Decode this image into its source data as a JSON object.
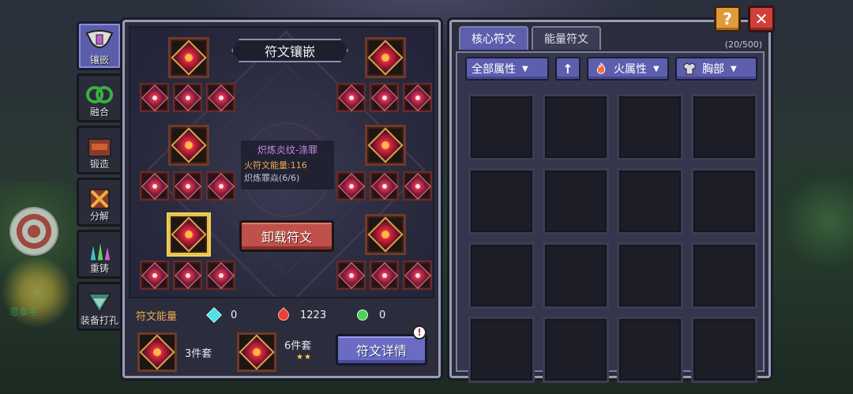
{
  "background": {
    "character_name": "恩泰手"
  },
  "tabs": [
    {
      "label": "镶嵌",
      "icon": "socket-icon",
      "active": true
    },
    {
      "label": "融合",
      "icon": "fusion-icon",
      "active": false
    },
    {
      "label": "锻造",
      "icon": "forge-icon",
      "active": false
    },
    {
      "label": "分解",
      "icon": "dismantle-icon",
      "active": false
    },
    {
      "label": "重铸",
      "icon": "recast-icon",
      "active": false
    },
    {
      "label": "装备打孔",
      "icon": "drill-icon",
      "active": false
    }
  ],
  "left_panel": {
    "title": "符文镶嵌",
    "tooltip": {
      "name": "炽炼炎纹-涤罪",
      "power": "火符文能量:116",
      "set": "炽炼罪焱(6/6)"
    },
    "unequip_label": "卸载符文",
    "energy": {
      "label": "符文能量",
      "cyan": "0",
      "red": "1223",
      "green": "0"
    },
    "sets": [
      {
        "label": "3件套",
        "stars": ""
      },
      {
        "label": "6件套",
        "stars": "★★"
      }
    ],
    "details_label": "符文详情",
    "alert": "!"
  },
  "right_panel": {
    "tabs": [
      {
        "label": "核心符文",
        "active": true
      },
      {
        "label": "能量符文",
        "active": false
      }
    ],
    "capacity": "(20/500)",
    "filters": {
      "attribute": "全部属性",
      "sort_icon": "up-arrow-icon",
      "element": "火属性",
      "slot": "胸部"
    },
    "grid_cells": 16
  },
  "colors": {
    "panel_border": "#9b9db7",
    "accent_purple": "#5c5eae",
    "unequip_red": "#c0504a",
    "energy_orange": "#f0a850",
    "tooltip_name": "#c48ce8"
  }
}
